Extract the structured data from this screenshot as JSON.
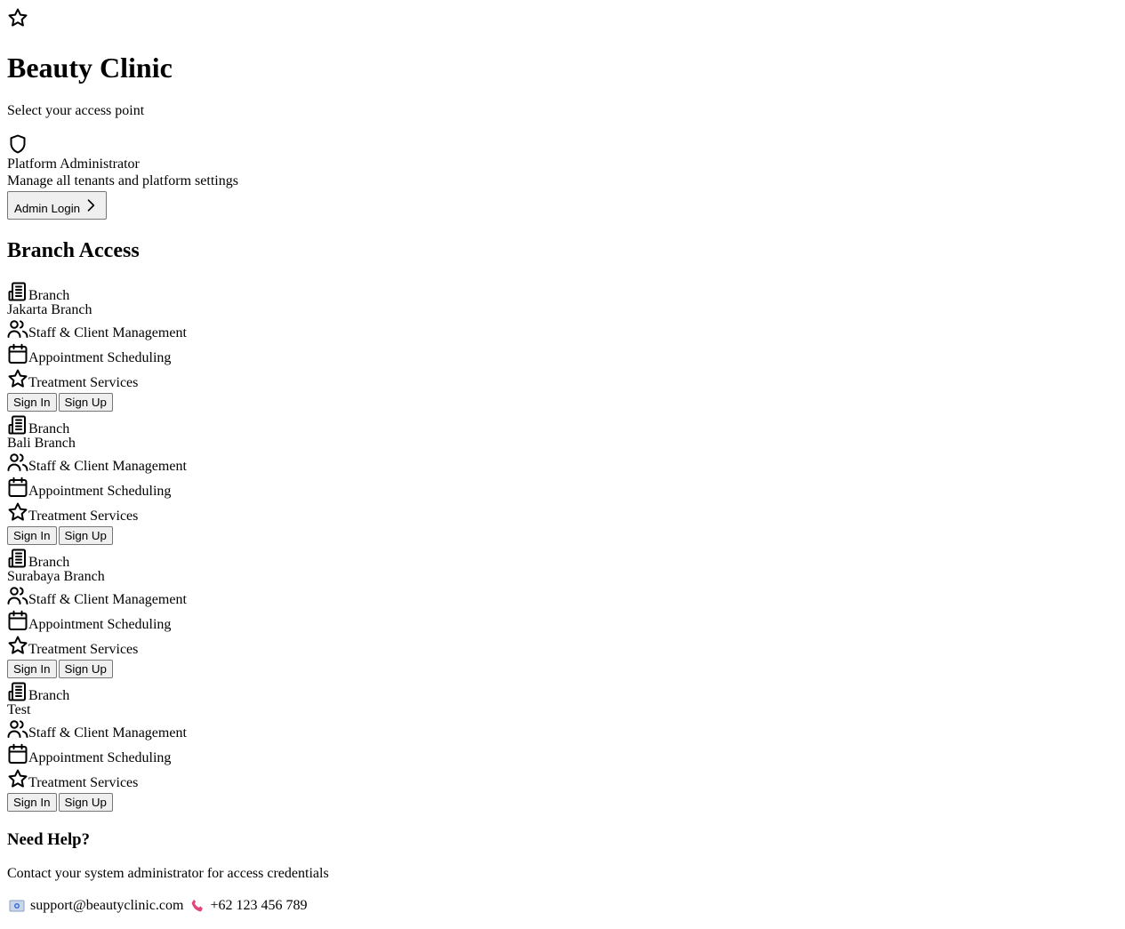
{
  "header": {
    "title": "Beauty Clinic",
    "subtitle": "Select your access point"
  },
  "admin": {
    "title": "Platform Administrator",
    "description": "Manage all tenants and platform settings",
    "login_label": "Admin Login"
  },
  "branch_section": {
    "heading": "Branch Access",
    "branches": [
      {
        "type_label": "Branch",
        "name": "Jakarta Branch",
        "features": [
          "Staff & Client Management",
          "Appointment Scheduling",
          "Treatment Services"
        ],
        "sign_in_label": "Sign In",
        "sign_up_label": "Sign Up"
      },
      {
        "type_label": "Branch",
        "name": "Bali Branch",
        "features": [
          "Staff & Client Management",
          "Appointment Scheduling",
          "Treatment Services"
        ],
        "sign_in_label": "Sign In",
        "sign_up_label": "Sign Up"
      },
      {
        "type_label": "Branch",
        "name": "Surabaya Branch",
        "features": [
          "Staff & Client Management",
          "Appointment Scheduling",
          "Treatment Services"
        ],
        "sign_in_label": "Sign In",
        "sign_up_label": "Sign Up"
      },
      {
        "type_label": "Branch",
        "name": "Test",
        "features": [
          "Staff & Client Management",
          "Appointment Scheduling",
          "Treatment Services"
        ],
        "sign_in_label": "Sign In",
        "sign_up_label": "Sign Up"
      }
    ]
  },
  "help": {
    "heading": "Need Help?",
    "text": "Contact your system administrator for access credentials",
    "email": "support@beautyclinic.com",
    "phone": "+62 123 456 789",
    "email_icon": "email-icon",
    "phone_icon": "phone-icon",
    "phone_icon_color": "#e0457b"
  }
}
